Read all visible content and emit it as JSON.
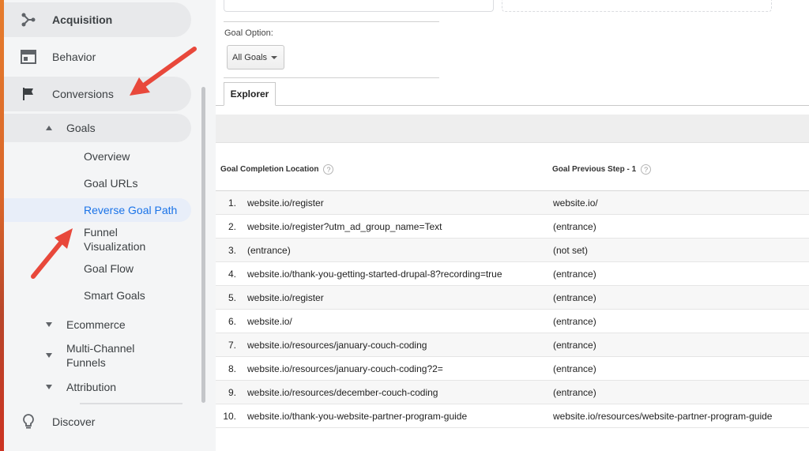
{
  "sidebar": {
    "acquisition": "Acquisition",
    "behavior": "Behavior",
    "conversions": "Conversions",
    "goals": "Goals",
    "goal_items": [
      "Overview",
      "Goal URLs",
      "Reverse Goal Path",
      "Funnel Visualization",
      "Goal Flow",
      "Smart Goals"
    ],
    "ecommerce": "Ecommerce",
    "multi_channel": "Multi-Channel Funnels",
    "attribution": "Attribution",
    "discover": "Discover",
    "active_item": "Reverse Goal Path"
  },
  "filters": {
    "goal_option_label": "Goal Option:",
    "goal_option_value": "All Goals"
  },
  "tabs": {
    "explorer": "Explorer"
  },
  "table": {
    "headers": [
      "Goal Completion Location",
      "Goal Previous Step - 1"
    ],
    "help_icon": "?",
    "rows": [
      [
        "1.",
        "website.io/register",
        "website.io/"
      ],
      [
        "2.",
        "website.io/register?utm_ad_group_name=Text",
        "(entrance)"
      ],
      [
        "3.",
        "(entrance)",
        "(not set)"
      ],
      [
        "4.",
        "website.io/thank-you-getting-started-drupal-8?recording=true",
        "(entrance)"
      ],
      [
        "5.",
        "website.io/register",
        "(entrance)"
      ],
      [
        "6.",
        "website.io/",
        "(entrance)"
      ],
      [
        "7.",
        "website.io/resources/january-couch-coding",
        "(entrance)"
      ],
      [
        "8.",
        "website.io/resources/january-couch-coding?2=",
        "(entrance)"
      ],
      [
        "9.",
        "website.io/resources/december-couch-coding",
        "(entrance)"
      ],
      [
        "10.",
        "website.io/thank-you-website-partner-program-guide",
        "website.io/resources/website-partner-program-guide"
      ]
    ]
  },
  "colors": {
    "accent": "#1a73e8",
    "annotation_arrow": "#e8483b",
    "sidebar_bg": "#f4f5f6"
  }
}
